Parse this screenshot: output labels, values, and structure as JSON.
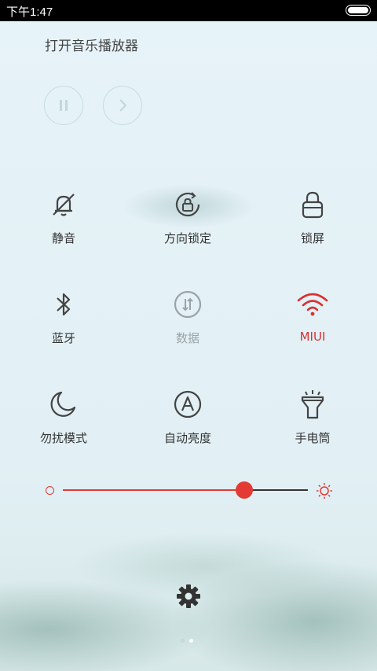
{
  "status_bar": {
    "time": "下午1:47",
    "battery_icon": "battery-icon"
  },
  "music": {
    "title": "打开音乐播放器",
    "subtitle": "",
    "pause_icon": "pause-icon",
    "next_icon": "next-icon"
  },
  "toggles": [
    {
      "label": "静音",
      "icon": "bell-off-icon",
      "state": "off"
    },
    {
      "label": "方向锁定",
      "icon": "rotation-lock-icon",
      "state": "off"
    },
    {
      "label": "锁屏",
      "icon": "lock-icon",
      "state": "off"
    },
    {
      "label": "蓝牙",
      "icon": "bluetooth-icon",
      "state": "off"
    },
    {
      "label": "数据",
      "icon": "mobile-data-icon",
      "state": "disabled"
    },
    {
      "label": "MIUI",
      "icon": "wifi-icon",
      "state": "on"
    },
    {
      "label": "勿扰模式",
      "icon": "moon-icon",
      "state": "off"
    },
    {
      "label": "自动亮度",
      "icon": "auto-brightness-icon",
      "state": "off"
    },
    {
      "label": "手电筒",
      "icon": "flashlight-icon",
      "state": "off"
    }
  ],
  "brightness": {
    "level": 0.74,
    "accent_color": "#e33a36"
  },
  "settings_icon": "gear-icon",
  "pager": {
    "pages": 2,
    "current": 2
  }
}
